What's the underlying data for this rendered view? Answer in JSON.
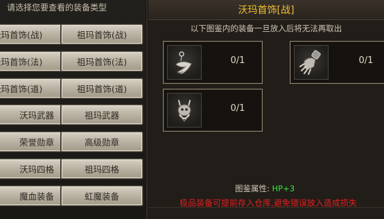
{
  "left": {
    "title": "请选择您要查看的装备类型",
    "buttons": [
      {
        "label": "沃玛首饰(战)"
      },
      {
        "label": "祖玛首饰(战)"
      },
      {
        "label": "沃玛首饰(法)"
      },
      {
        "label": "祖玛首饰(法)"
      },
      {
        "label": "沃玛首饰(道)"
      },
      {
        "label": "祖玛首饰(道)"
      },
      {
        "label": "沃玛武器"
      },
      {
        "label": "祖玛武器"
      },
      {
        "label": "荣誉勋章"
      },
      {
        "label": "高级勋章"
      },
      {
        "label": "沃玛四格"
      },
      {
        "label": "祖玛四格"
      },
      {
        "label": "魔血装备"
      },
      {
        "label": "虹魔装备"
      }
    ]
  },
  "right": {
    "title": "沃玛首饰[战]",
    "subtitle": "以下图鉴内的装备一旦放入后将无法再取出",
    "slots": [
      {
        "icon": "tooth-necklace-icon",
        "count": "0/1"
      },
      {
        "icon": "gauntlet-icon",
        "count": "0/1"
      },
      {
        "icon": "skull-ring-icon",
        "count": "0/1"
      }
    ],
    "attr_label": "图鉴属性:",
    "attr_value": "HP+3",
    "warning": "极品装备可提前存入仓库,避免错误放入造成损失"
  },
  "colors": {
    "title": "#f0c030",
    "attr_value": "#3ee03e",
    "warning": "#e02020"
  }
}
